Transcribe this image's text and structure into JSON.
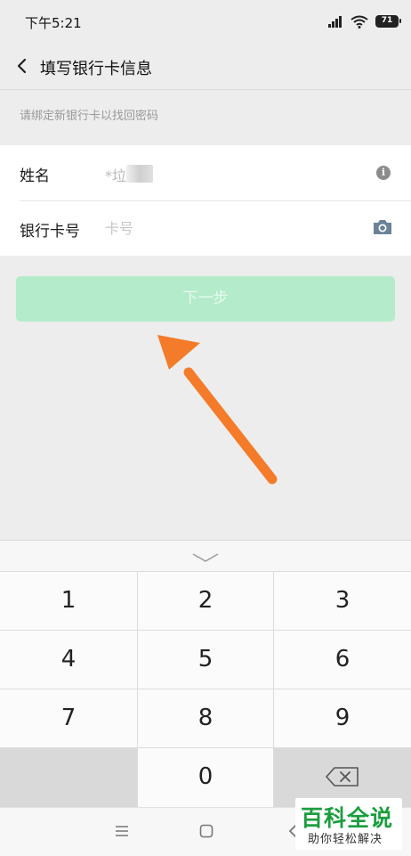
{
  "status_bar": {
    "time": "下午5:21",
    "battery": "71"
  },
  "header": {
    "title": "填写银行卡信息"
  },
  "hint": "请绑定新银行卡以找回密码",
  "form": {
    "name_label": "姓名",
    "name_value": "*垃",
    "card_label": "银行卡号",
    "card_placeholder": "卡号",
    "card_value": ""
  },
  "next_button": {
    "label": "下一步"
  },
  "keypad": {
    "keys": [
      "1",
      "2",
      "3",
      "4",
      "5",
      "6",
      "7",
      "8",
      "9",
      "0"
    ]
  },
  "watermark": {
    "title": "百科全说",
    "subtitle": "助你轻松解决"
  },
  "colors": {
    "accent_disabled": "#b4eccb",
    "annotation_arrow": "#f47b2a",
    "watermark_green": "#1b9e3e",
    "background": "#ededed"
  }
}
